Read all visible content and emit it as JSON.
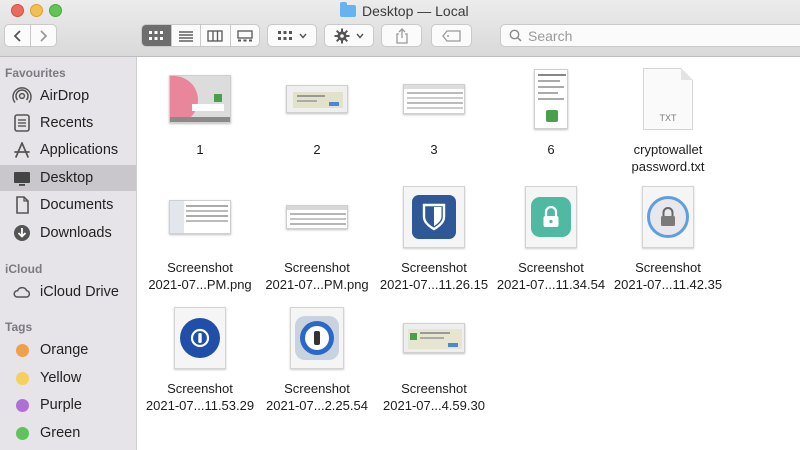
{
  "window": {
    "title": "Desktop — Local"
  },
  "search": {
    "placeholder": "Search"
  },
  "sidebar": {
    "favourites_title": "Favourites",
    "favourites": [
      {
        "label": "AirDrop",
        "icon": "airdrop-icon"
      },
      {
        "label": "Recents",
        "icon": "recents-icon"
      },
      {
        "label": "Applications",
        "icon": "applications-icon"
      },
      {
        "label": "Desktop",
        "icon": "desktop-icon",
        "selected": true
      },
      {
        "label": "Documents",
        "icon": "documents-icon"
      },
      {
        "label": "Downloads",
        "icon": "downloads-icon"
      }
    ],
    "icloud_title": "iCloud",
    "icloud": [
      {
        "label": "iCloud Drive",
        "icon": "cloud-icon"
      }
    ],
    "tags_title": "Tags",
    "tags": [
      {
        "label": "Orange",
        "color": "#f0a04b"
      },
      {
        "label": "Yellow",
        "color": "#f5d060"
      },
      {
        "label": "Purple",
        "color": "#b06fd6"
      },
      {
        "label": "Green",
        "color": "#5fc35c"
      }
    ]
  },
  "files": [
    {
      "line1": "1",
      "line2": ""
    },
    {
      "line1": "2",
      "line2": ""
    },
    {
      "line1": "3",
      "line2": ""
    },
    {
      "line1": "6",
      "line2": ""
    },
    {
      "line1": "cryptowallet",
      "line2": "password.txt",
      "badge": "TXT"
    },
    {
      "line1": "Screenshot",
      "line2": "2021-07...PM.png"
    },
    {
      "line1": "Screenshot",
      "line2": "2021-07...PM.png"
    },
    {
      "line1": "Screenshot",
      "line2": "2021-07...11.26.15"
    },
    {
      "line1": "Screenshot",
      "line2": "2021-07...11.34.54"
    },
    {
      "line1": "Screenshot",
      "line2": "2021-07...11.42.35"
    },
    {
      "line1": "Screenshot",
      "line2": "2021-07...11.53.29"
    },
    {
      "line1": "Screenshot",
      "line2": "2021-07...2.25.54"
    },
    {
      "line1": "Screenshot",
      "line2": "2021-07...4.59.30"
    }
  ],
  "colors": {
    "selection": "#c9c7cc",
    "sidebar": "#e6e4e8",
    "accent_blue": "#1f4fa8"
  }
}
